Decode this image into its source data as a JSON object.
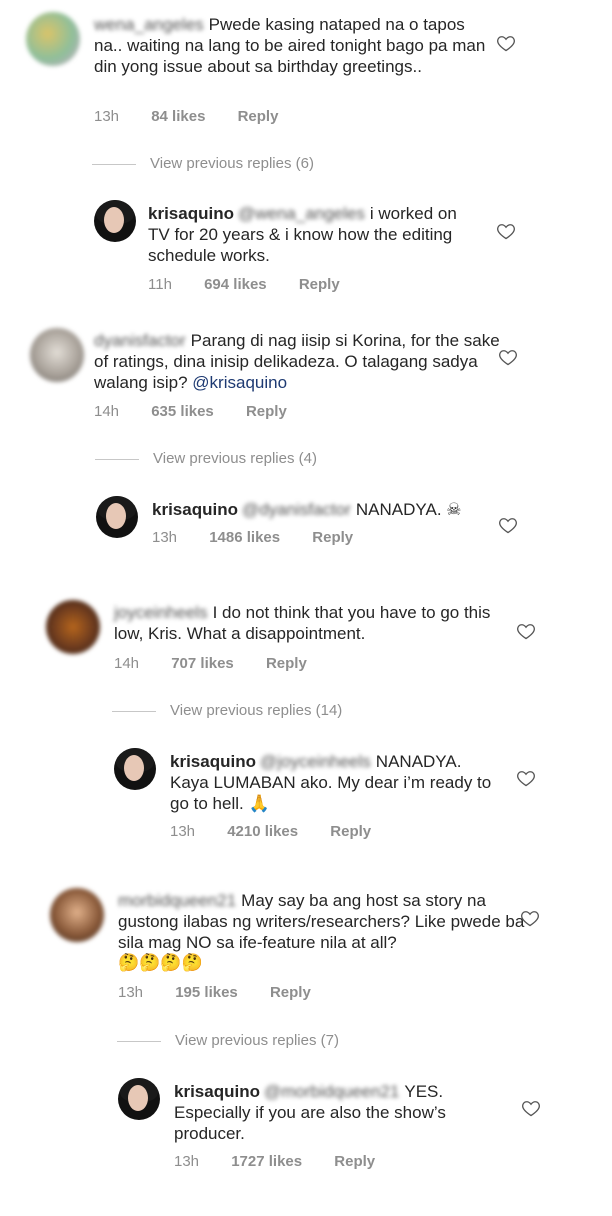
{
  "threads": [
    {
      "parent": {
        "username": "wena_angeles",
        "text": "Pwede kasing nataped na o tapos na.. waiting na lang to be aired tonight bago pa man din yong issue about sa birthday greetings..",
        "time": "13h",
        "likes": "84 likes",
        "reply": "Reply"
      },
      "view_previous": "View previous replies (6)",
      "reply": {
        "username": "krisaquino",
        "mention": "@wena_angeles",
        "text": "i worked on TV for 20 years & i know how the editing schedule works.",
        "time": "11h",
        "likes": "694 likes",
        "reply": "Reply"
      }
    },
    {
      "parent": {
        "username": "dyanisfactor",
        "text": "Parang di nag iisip si Korina, for the sake of ratings, dina inisip delikadeza. O talagang sadya walang isip?",
        "mention": "@krisaquino",
        "time": "14h",
        "likes": "635 likes",
        "reply": "Reply"
      },
      "view_previous": "View previous replies (4)",
      "reply": {
        "username": "krisaquino",
        "mention": "@dyanisfactor",
        "text": "NANADYA. ☠",
        "time": "13h",
        "likes": "1486 likes",
        "reply": "Reply"
      }
    },
    {
      "parent": {
        "username": "joyceinheels",
        "text": "I do not think that you have to go this low, Kris. What a disappointment.",
        "time": "14h",
        "likes": "707 likes",
        "reply": "Reply"
      },
      "view_previous": "View previous replies (14)",
      "reply": {
        "username": "krisaquino",
        "mention": "@joyceinheels",
        "text": "NANADYA. Kaya LUMABAN ako. My dear i’m ready to go to hell. 🙏",
        "time": "13h",
        "likes": "4210 likes",
        "reply": "Reply"
      }
    },
    {
      "parent": {
        "username": "morbidqueen21",
        "text": "May say ba ang host sa story na gustong ilabas ng writers/researchers? Like pwede ba sila mag NO sa ife-feature nila at all?",
        "emoji": "🤔🤔🤔🤔",
        "time": "13h",
        "likes": "195 likes",
        "reply": "Reply"
      },
      "view_previous": "View previous replies (7)",
      "reply": {
        "username": "krisaquino",
        "mention": "@morbidqueen21",
        "text": "YES. Especially if you are also the show’s producer.",
        "time": "13h",
        "likes": "1727 likes",
        "reply": "Reply"
      }
    }
  ],
  "colors": {
    "text": "#262626",
    "meta": "#8e8e8e",
    "mention": "#1e3a72"
  },
  "icons": {
    "like": "heart-outline-icon"
  }
}
